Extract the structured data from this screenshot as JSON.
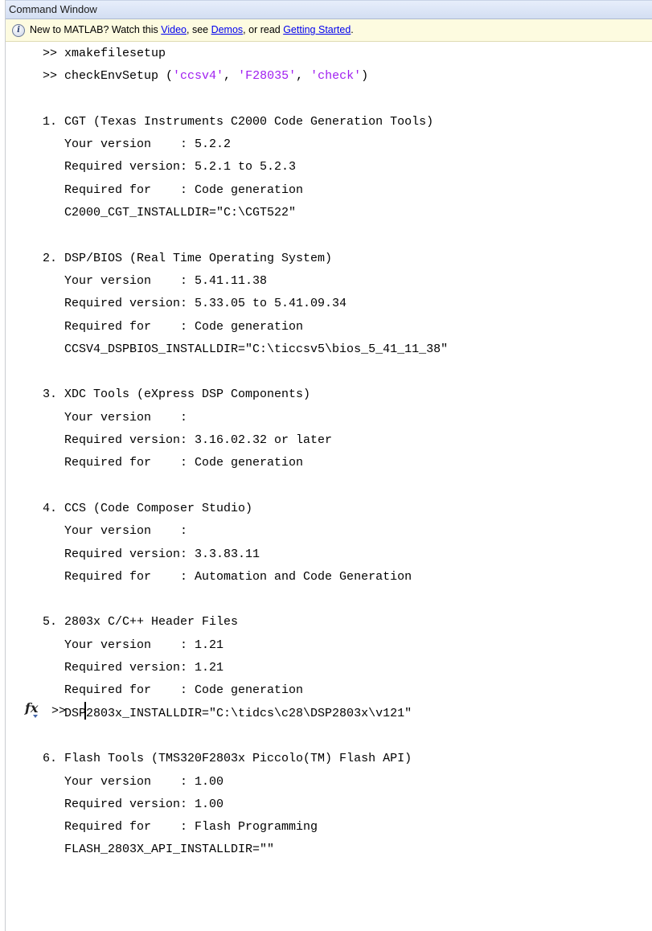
{
  "window": {
    "title": "Command Window"
  },
  "info_bar": {
    "prefix": "New to MATLAB? Watch this ",
    "link_video": "Video",
    "mid1": ", see ",
    "link_demos": "Demos",
    "mid2": ", or read ",
    "link_getting_started": "Getting Started",
    "suffix": "."
  },
  "console": {
    "cmd1": ">> xmakefilesetup",
    "cmd2_prefix": ">> checkEnvSetup (",
    "cmd2_arg1": "'ccsv4'",
    "cmd2_sep1": ", ",
    "cmd2_arg2": "'F28035'",
    "cmd2_sep2": ", ",
    "cmd2_arg3": "'check'",
    "cmd2_suffix": ")",
    "sections": [
      {
        "lines": [
          "1. CGT (Texas Instruments C2000 Code Generation Tools)",
          "   Your version    : 5.2.2",
          "   Required version: 5.2.1 to 5.2.3",
          "   Required for    : Code generation",
          "   C2000_CGT_INSTALLDIR=\"C:\\CGT522\""
        ]
      },
      {
        "lines": [
          "2. DSP/BIOS (Real Time Operating System)",
          "   Your version    : 5.41.11.38",
          "   Required version: 5.33.05 to 5.41.09.34",
          "   Required for    : Code generation",
          "   CCSV4_DSPBIOS_INSTALLDIR=\"C:\\ticcsv5\\bios_5_41_11_38\""
        ]
      },
      {
        "lines": [
          "3. XDC Tools (eXpress DSP Components)",
          "   Your version    :",
          "   Required version: 3.16.02.32 or later",
          "   Required for    : Code generation"
        ]
      },
      {
        "lines": [
          "4. CCS (Code Composer Studio)",
          "   Your version    :",
          "   Required version: 3.3.83.11",
          "   Required for    : Automation and Code Generation"
        ]
      },
      {
        "lines": [
          "5. 2803x C/C++ Header Files",
          "   Your version    : 1.21",
          "   Required version: 1.21",
          "   Required for    : Code generation",
          "   DSP2803x_INSTALLDIR=\"C:\\tidcs\\c28\\DSP2803x\\v121\""
        ]
      },
      {
        "lines": [
          "6. Flash Tools (TMS320F2803x Piccolo(TM) Flash API)",
          "   Your version    : 1.00",
          "   Required version: 1.00",
          "   Required for    : Flash Programming",
          "   FLASH_2803X_API_INSTALLDIR=\"\""
        ]
      }
    ],
    "prompt": ">>"
  },
  "icons": {
    "info": "info-icon",
    "function_browser": "fx-icon"
  }
}
